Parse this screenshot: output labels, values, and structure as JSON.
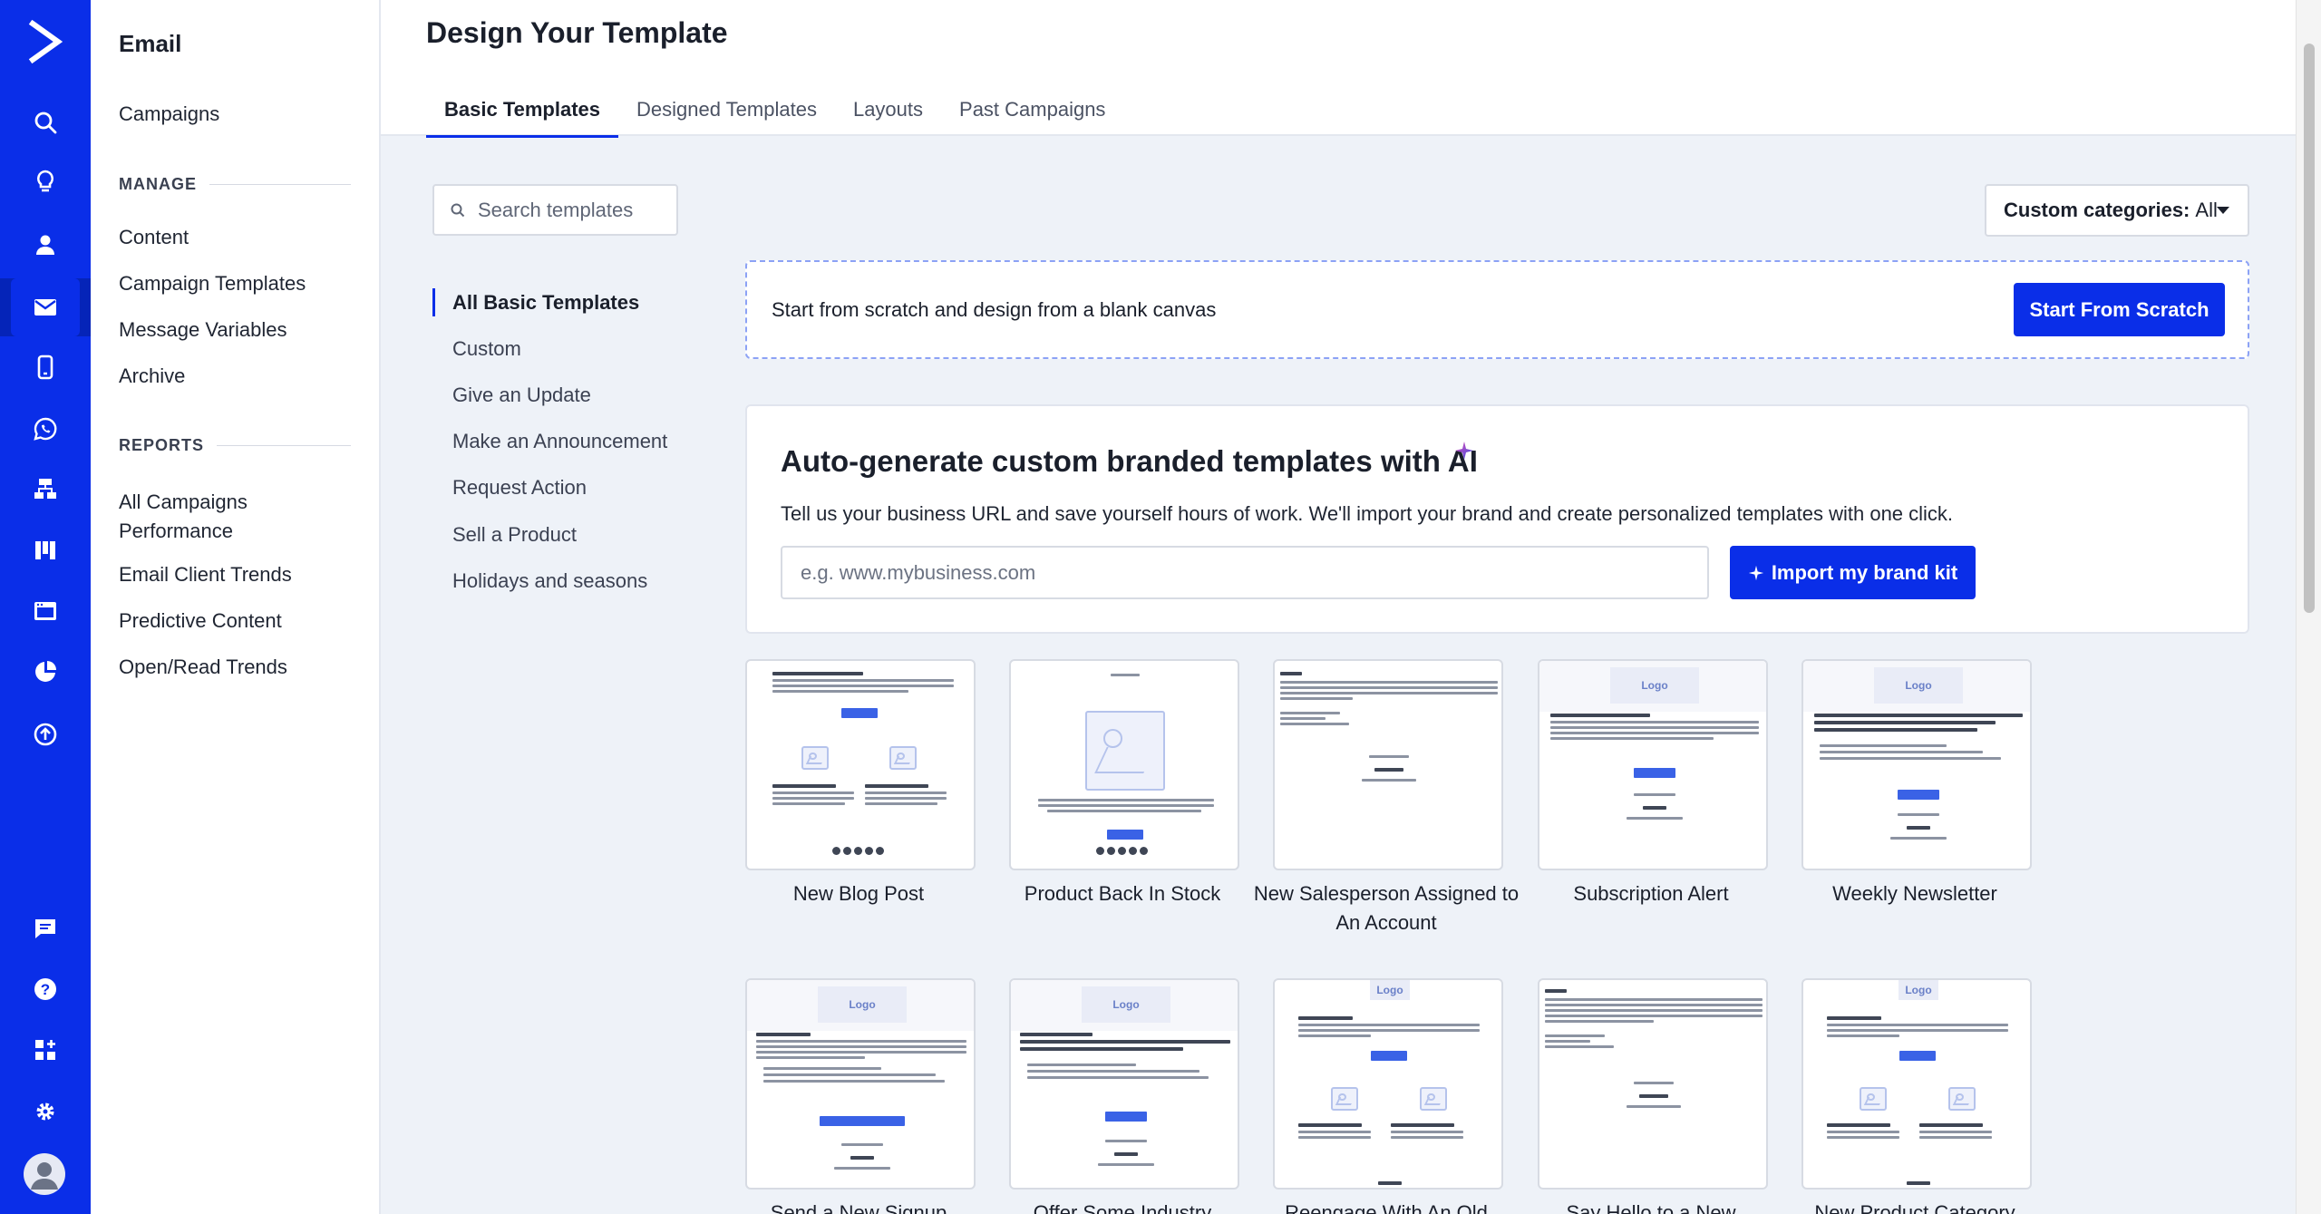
{
  "app": {
    "section_title": "Email",
    "page_title": "Design Your Template"
  },
  "subnav": {
    "campaigns": "Campaigns",
    "manage_header": "MANAGE",
    "manage_items": [
      "Content",
      "Campaign Templates",
      "Message Variables",
      "Archive"
    ],
    "reports_header": "REPORTS",
    "reports_items": [
      "All Campaigns Performance",
      "Email Client Trends",
      "Predictive Content",
      "Open/Read Trends"
    ]
  },
  "rail": {
    "icons": [
      "search-icon",
      "lightbulb-icon",
      "contacts-icon",
      "email-icon",
      "sms-icon",
      "whatsapp-icon",
      "automations-icon",
      "deals-icon",
      "website-icon",
      "reports-icon",
      "upload-icon",
      "conversations-icon",
      "help-icon",
      "apps-icon",
      "settings-icon",
      "avatar"
    ],
    "active": "email-icon",
    "brand_color": "#0a2ee8"
  },
  "tabs": [
    "Basic Templates",
    "Designed Templates",
    "Layouts",
    "Past Campaigns"
  ],
  "active_tab": "Basic Templates",
  "search": {
    "placeholder": "Search templates"
  },
  "categories": [
    "All Basic Templates",
    "Custom",
    "Give an Update",
    "Make an Announcement",
    "Request Action",
    "Sell a Product",
    "Holidays and seasons"
  ],
  "active_category": "All Basic Templates",
  "custom_categories": {
    "label": "Custom categories:",
    "value": "All"
  },
  "scratch": {
    "text": "Start from scratch and design from a blank canvas",
    "button": "Start From Scratch"
  },
  "ai": {
    "title": "Auto-generate custom branded templates with AI",
    "description": "Tell us your business URL and save yourself hours of work. We'll import your brand and create personalized templates with one click.",
    "placeholder": "e.g. www.mybusiness.com",
    "button": "Import my brand kit"
  },
  "templates": [
    {
      "name": "New Blog Post"
    },
    {
      "name": "Product Back In Stock"
    },
    {
      "name": "New Salesperson Assigned to An Account"
    },
    {
      "name": "Subscription Alert"
    },
    {
      "name": "Weekly Newsletter"
    },
    {
      "name": "Send a New Signup"
    },
    {
      "name": "Offer Some Industry"
    },
    {
      "name": "Reengage With An Old"
    },
    {
      "name": "Say Hello to a New"
    },
    {
      "name": "New Product Category"
    }
  ],
  "thumb_text": {
    "logo": "Logo"
  }
}
